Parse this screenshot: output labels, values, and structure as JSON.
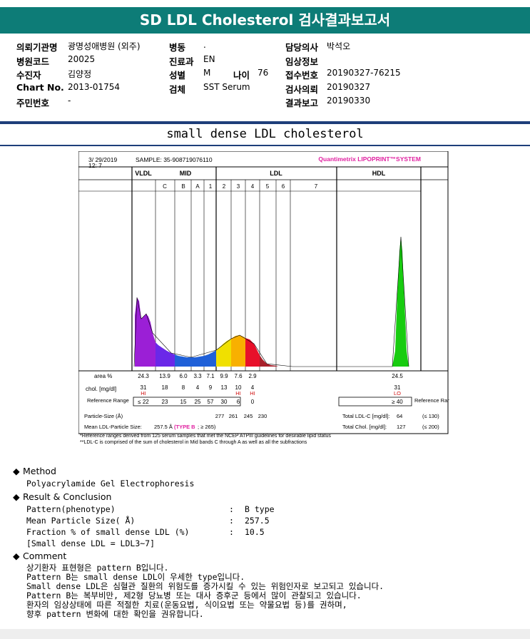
{
  "header": {
    "title": "SD LDL Cholesterol 검사결과보고서"
  },
  "info": {
    "rows": [
      [
        {
          "label": "의뢰기관명",
          "value": "광명성애병원 (외주)"
        },
        {
          "label": "병동",
          "value": "."
        },
        {
          "label": "담당의사",
          "value": "박석오"
        }
      ],
      [
        {
          "label": "병원코드",
          "value": "20025"
        },
        {
          "label": "진료과",
          "value": "EN"
        },
        {
          "label": "임상정보",
          "value": ""
        }
      ],
      [
        {
          "label": "수진자",
          "value": "김양정"
        },
        {
          "label": "성별",
          "value": "M"
        },
        {
          "label": "접수번호",
          "value": "20190327-76215"
        }
      ],
      [
        {
          "label": "Chart No.",
          "value": "2013-01754"
        },
        {
          "label": "검체",
          "value": "SST Serum"
        },
        {
          "label": "검사의뢰",
          "value": "20190327"
        }
      ],
      [
        {
          "label": "주민번호",
          "value": "-"
        },
        {
          "label": "",
          "value": ""
        },
        {
          "label": "결과보고",
          "value": "20190330"
        }
      ]
    ],
    "age_label": "나이",
    "age_value": "76"
  },
  "subtitle": "small dense LDL cholesterol",
  "chart_data": {
    "type": "area",
    "date": "3/ 29/2019",
    "time": "12: 7",
    "sample": "SAMPLE:  35-908719076110",
    "brand": "Quantimetrix LIPOPRINT™SYSTEM",
    "groups": [
      "VLDL",
      "MID",
      "LDL",
      "HDL"
    ],
    "bands": [
      "C",
      "B",
      "A",
      "1",
      "2",
      "3",
      "4",
      "5",
      "6",
      "7"
    ],
    "rows": {
      "area_label": "area %",
      "area": [
        "24.3",
        "13.9",
        "6.0",
        "3.3",
        "7.1",
        "9.9",
        "7.6",
        "2.9",
        "",
        "",
        "",
        "24.5"
      ],
      "chol_label": "chol. [mg/dl]",
      "chol": [
        "31",
        "18",
        "8",
        "4",
        "9",
        "13",
        "10",
        "4",
        "",
        "",
        "",
        "31"
      ],
      "flags": [
        "HI",
        "",
        "",
        "",
        "",
        "",
        "HI",
        "HI",
        "",
        "",
        "",
        "LO"
      ],
      "ref_label": "Reference Range",
      "ref": [
        "≤ 22",
        "23",
        "15",
        "25",
        "57",
        "30",
        "6",
        "0",
        "",
        "",
        "",
        "≥ 40"
      ],
      "ref_label_right": "Reference Range",
      "particle_label": "Particle-Size (Å)",
      "particle": [
        "277",
        "261",
        "245",
        "230"
      ],
      "mean_label": "Mean LDL-Particle Size:",
      "mean_value": "257.5 Å",
      "mean_type": "(TYPE B",
      "mean_ref": "; ≥ 265)",
      "total_ldl_label": "Total LDL-C [mg/dl]:",
      "total_ldl": "64",
      "total_ldl_ref": "(≤ 130)",
      "total_chol_label": "Total Chol. [mg/dl]:",
      "total_chol": "127",
      "total_chol_ref": "(≤ 200)"
    },
    "footnotes": [
      "*Reference ranges derived from 125 serum samples that met the NCEP ATPIII guidelines for desirable lipid status",
      "**LDL-C is comprised of the sum of cholesterol in Mid bands C through A as well as all the subfractions"
    ],
    "colors": {
      "vldl": "#9b1fd6",
      "mid_c": "#6a28e8",
      "mid": "#1f60d8",
      "ldl1": "#f0e000",
      "ldl2": "#f8b000",
      "ldl3": "#e8102a",
      "ldl4": "#a8202a",
      "hdl": "#18cc10"
    }
  },
  "sections": {
    "method": {
      "title": "Method",
      "text": "Polyacrylamide Gel Electrophoresis"
    },
    "result": {
      "title": "Result & Conclusion",
      "lines": [
        {
          "k": "Pattern(phenotype)",
          "v": "B type"
        },
        {
          "k": "Mean Particle Size( Å)",
          "v": "257.5"
        },
        {
          "k": "Fraction % of small dense LDL (%)",
          "v": "10.5"
        }
      ],
      "note": "[Small dense LDL = LDL3~7]"
    },
    "comment": {
      "title": "Comment",
      "lines": [
        "상기환자 표현형은 pattern B입니다.",
        "Pattern B는 small dense LDL이 우세한 type입니다.",
        "Small dense LDL은 심혈관 질환의 위험도를 증가시킬 수 있는 위험인자로 보고되고 있습니다.",
        "Pattern B는 복부비만, 제2형 당뇨병 또는 대사 증후군 등에서 많이 관찰되고 있습니다.",
        "환자의 임상상태에 따른 적절한 치료(운동요법, 식이요법 또는 약물요법 등)를 권하며,",
        "향후 pattern 변화에 대한 확인을 권유합니다."
      ]
    }
  }
}
